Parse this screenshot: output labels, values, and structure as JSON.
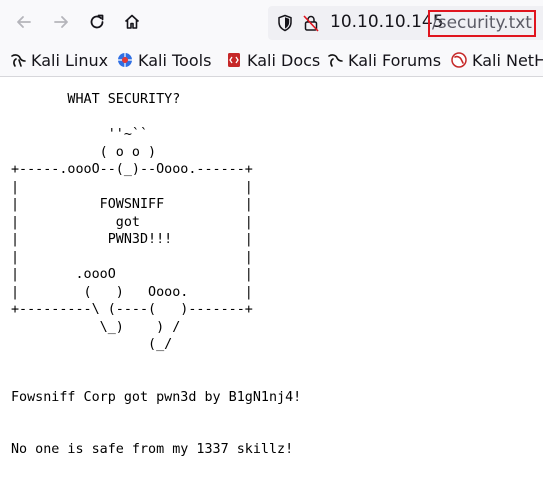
{
  "browser": {
    "url_host": "10.10.10.145",
    "url_path": "/security.txt"
  },
  "bookmarks": [
    {
      "label": "Kali Linux",
      "icon": "kali-dragon-icon"
    },
    {
      "label": "Kali Tools",
      "icon": "kali-tools-icon"
    },
    {
      "label": "Kali Docs",
      "icon": "kali-docs-icon"
    },
    {
      "label": "Kali Forums",
      "icon": "kali-forums-icon"
    },
    {
      "label": "Kali NetH",
      "icon": "kali-nethunter-icon"
    }
  ],
  "page": {
    "text": "       WHAT SECURITY?\n\n            ''~``\n           ( o o )\n+-----.oooO--(_)--Oooo.------+\n|                            |\n|          FOWSNIFF          |\n|            got             |\n|           PWN3D!!!         |\n|                            |\n|       .oooO                |\n|        (   )   Oooo.       |\n+---------\\ (----(   )-------+\n           \\_)    ) /\n                 (_/\n\n\nFowsniff Corp got pwn3d by B1gN1nj4!\n\n\nNo one is safe from my 1337 skillz!"
  },
  "colors": {
    "highlight_box": "#e0141e",
    "toolbar_bg": "#f9f9fb",
    "urlbar_bg": "#f0f0f4"
  }
}
